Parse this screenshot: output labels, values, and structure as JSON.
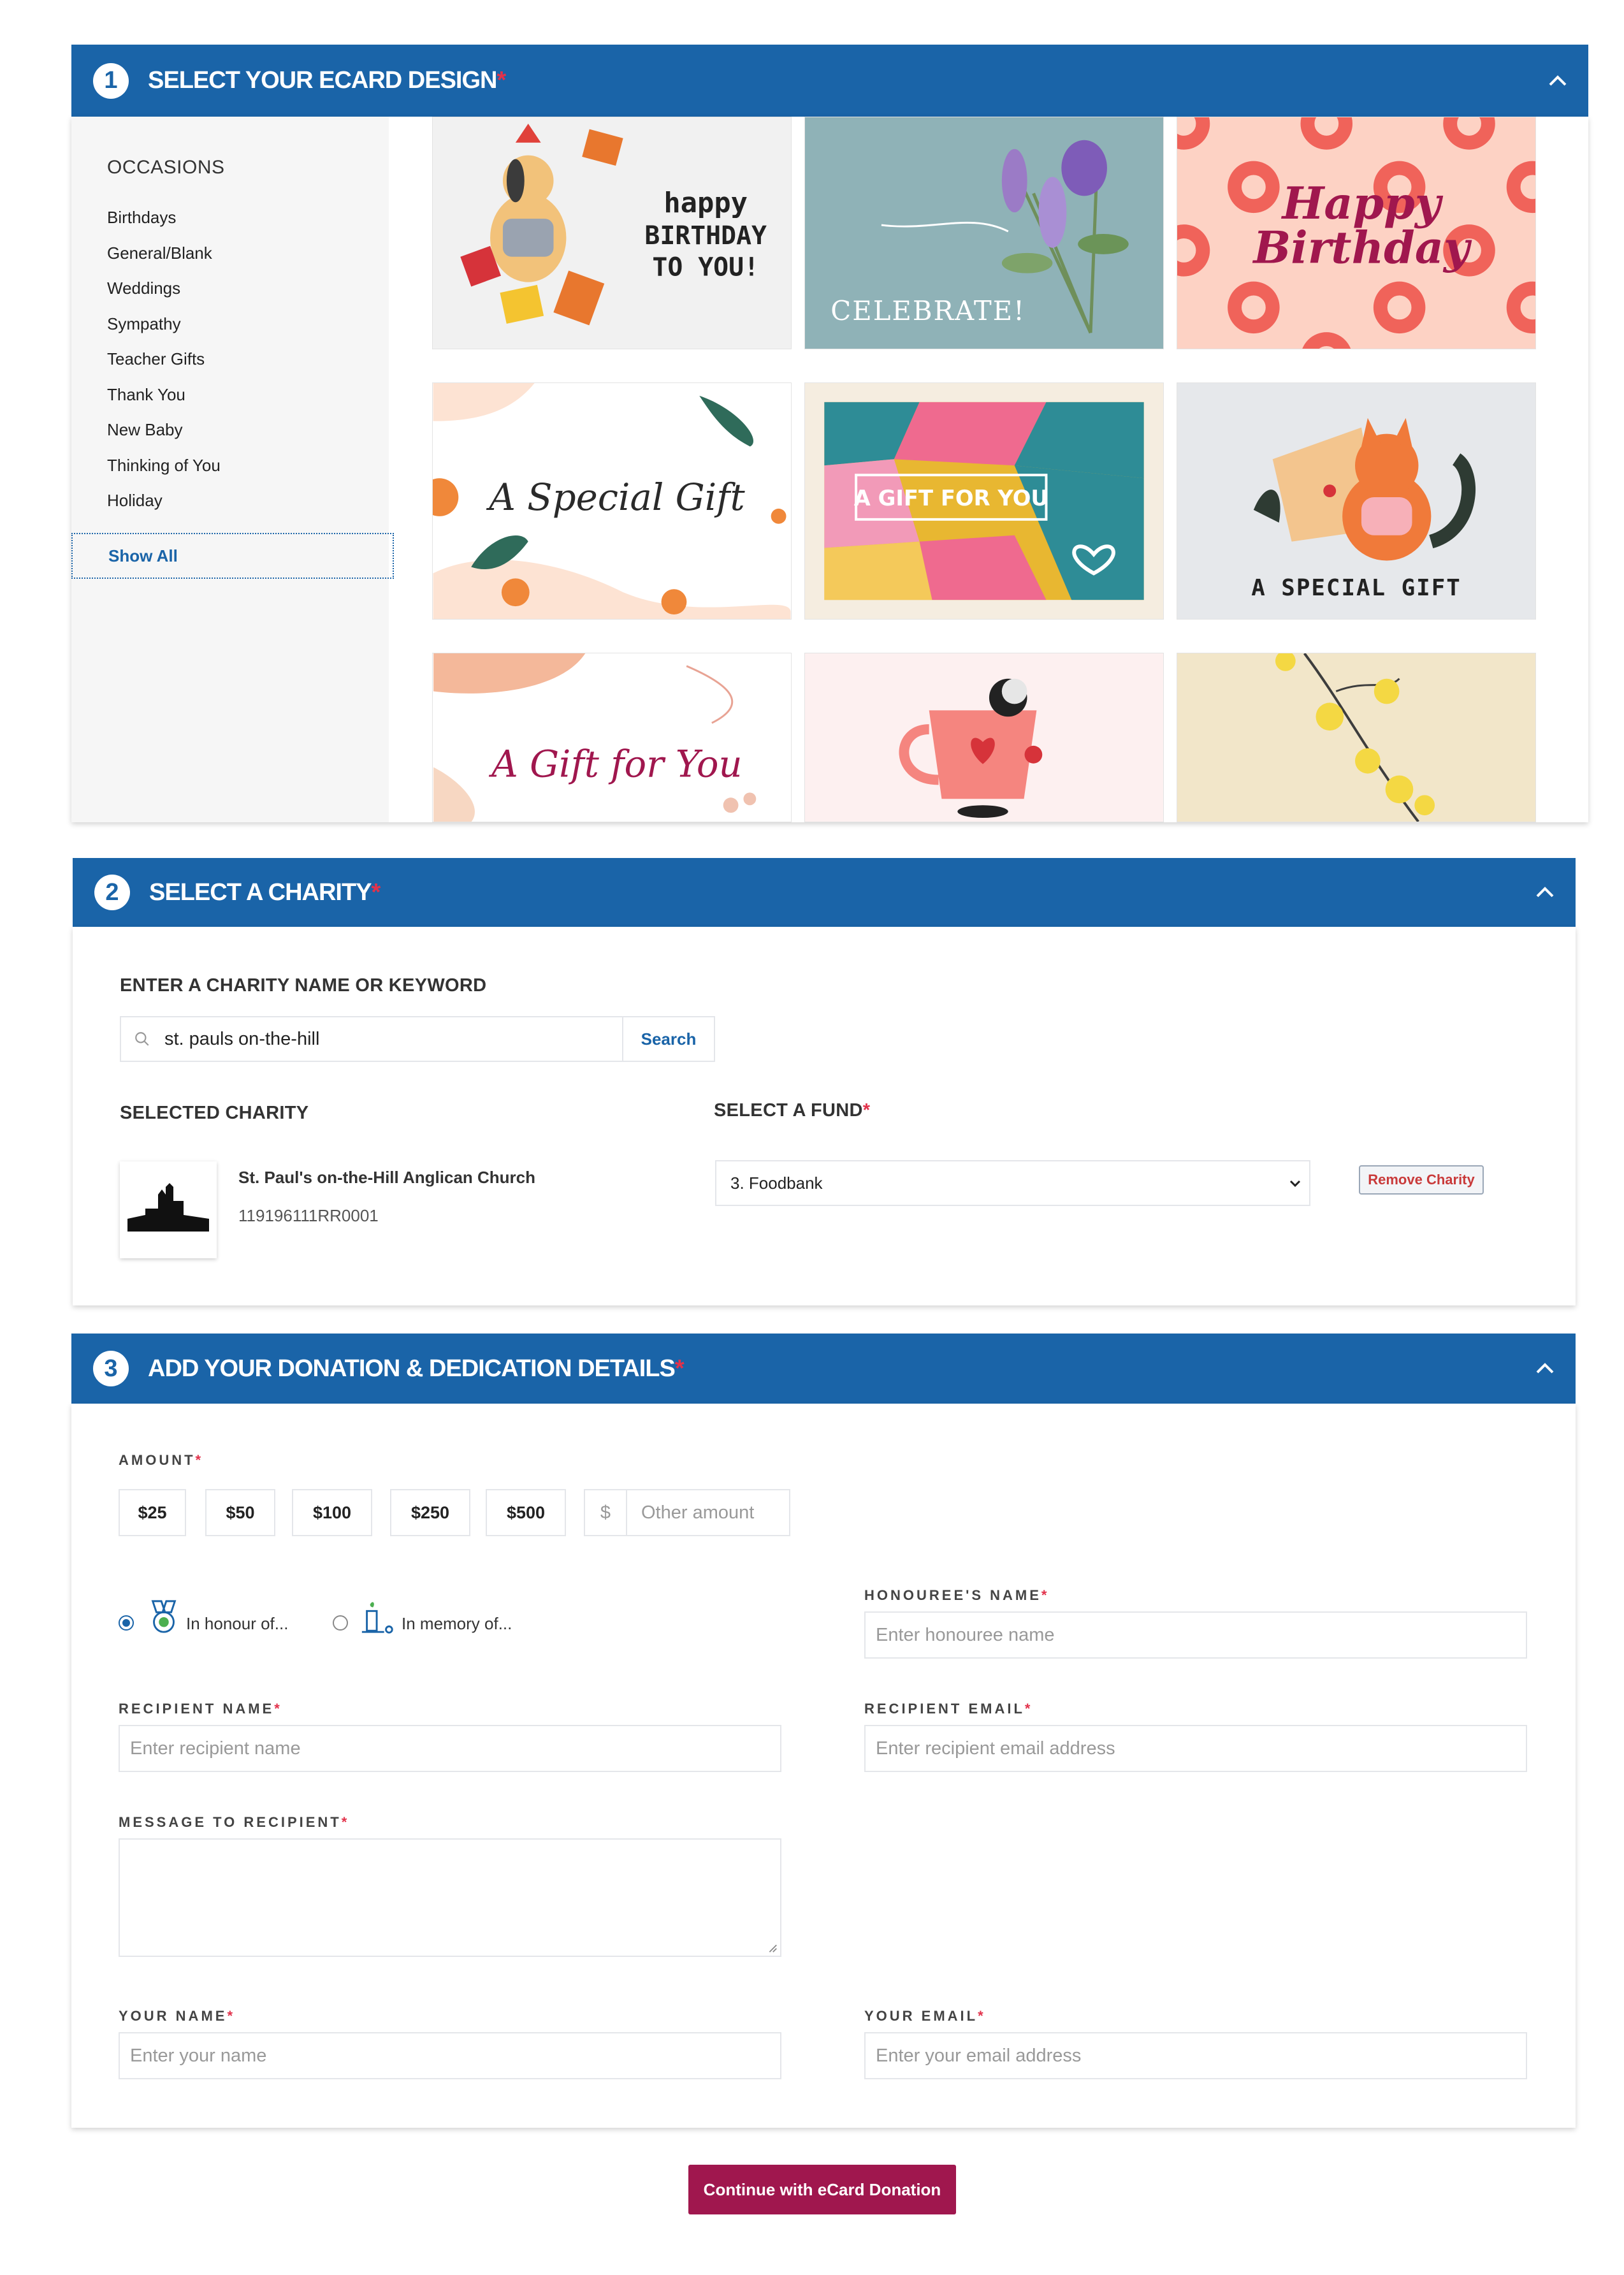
{
  "section1": {
    "number": "1",
    "title": "SELECT YOUR ECARD DESIGN",
    "required_mark": "*",
    "occasions_title": "OCCASIONS",
    "occasions": [
      "Birthdays",
      "General/Blank",
      "Weddings",
      "Sympathy",
      "Teacher Gifts",
      "Thank You",
      "New Baby",
      "Thinking of You",
      "Holiday"
    ],
    "show_all": "Show All",
    "cards": [
      {
        "lines": [
          "happy",
          "BIRTHDAY",
          "TO YOU!"
        ],
        "bg": "#f1f1f1"
      },
      {
        "lines": [
          "CELEBRATE!"
        ],
        "bg": "#8fb2b7"
      },
      {
        "lines": [
          "Happy",
          "Birthday"
        ],
        "bg": "#fdd2c4"
      },
      {
        "lines": [
          "A Special Gift"
        ],
        "bg": "#ffffff"
      },
      {
        "lines": [
          "A GIFT FOR YOU"
        ],
        "bg": "#f5ede0"
      },
      {
        "lines": [
          "A SPECIAL GIFT"
        ],
        "bg": "#e6e8eb"
      },
      {
        "lines": [
          "A Gift for You"
        ],
        "bg": "#ffffff"
      },
      {
        "lines": [],
        "bg": "#fdf0f0"
      },
      {
        "lines": [],
        "bg": "#f2e6c9"
      }
    ]
  },
  "section2": {
    "number": "2",
    "title": "SELECT A CHARITY",
    "required_mark": "*",
    "search_label": "ENTER A CHARITY NAME OR KEYWORD",
    "search_value": "st. pauls on-the-hill",
    "search_button": "Search",
    "selected_label": "SELECTED CHARITY",
    "fund_label": "SELECT A FUND",
    "charity_name": "St. Paul's on-the-Hill Anglican Church",
    "charity_number": "119196111RR0001",
    "fund_value": "3. Foodbank",
    "remove_button": "Remove Charity"
  },
  "section3": {
    "number": "3",
    "title": "ADD YOUR DONATION & DEDICATION DETAILS",
    "required_mark": "*",
    "amount_label": "AMOUNT",
    "amounts": [
      "$25",
      "$50",
      "$100",
      "$250",
      "$500"
    ],
    "currency": "$",
    "other_placeholder": "Other amount",
    "honour_label": "In honour of...",
    "memory_label": "In memory of...",
    "honouree_label": "HONOUREE'S NAME",
    "honouree_placeholder": "Enter honouree name",
    "recipient_name_label": "RECIPIENT NAME",
    "recipient_name_placeholder": "Enter recipient name",
    "recipient_email_label": "RECIPIENT EMAIL",
    "recipient_email_placeholder": "Enter recipient email address",
    "message_label": "MESSAGE TO RECIPIENT",
    "your_name_label": "YOUR NAME",
    "your_name_placeholder": "Enter your name",
    "your_email_label": "YOUR EMAIL",
    "your_email_placeholder": "Enter your email address"
  },
  "continue_button": "Continue with eCard Donation",
  "colors": {
    "header": "#1a64a8",
    "required": "#e2324b",
    "continue": "#a0174e"
  }
}
